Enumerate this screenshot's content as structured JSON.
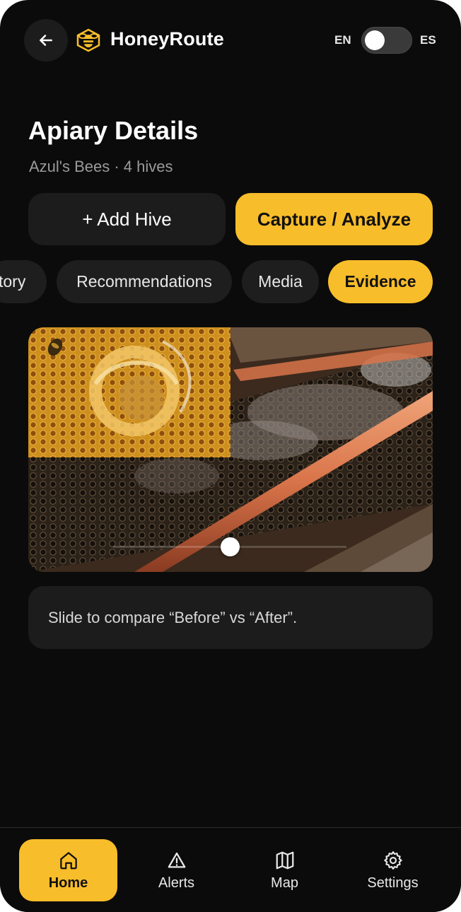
{
  "app": {
    "title": "HoneyRoute",
    "lang_left": "EN",
    "lang_right": "ES",
    "language_toggle_on": false
  },
  "page": {
    "title": "Apiary Details",
    "subtitle": "Azul's Bees · 4 hives"
  },
  "actions": {
    "add_hive": "+ Add Hive",
    "capture": "Capture / Analyze"
  },
  "tabs": [
    {
      "label": "tory",
      "active": false
    },
    {
      "label": "Recommendations",
      "active": false
    },
    {
      "label": "Media",
      "active": false
    },
    {
      "label": "Evidence",
      "active": true
    }
  ],
  "compare": {
    "slider_position": 0.5,
    "hint": "Slide to compare “Before” vs “After”."
  },
  "nav": [
    {
      "label": "Home",
      "icon": "home-icon",
      "active": true
    },
    {
      "label": "Alerts",
      "icon": "alert-triangle-icon",
      "active": false
    },
    {
      "label": "Map",
      "icon": "map-icon",
      "active": false
    },
    {
      "label": "Settings",
      "icon": "gear-icon",
      "active": false
    }
  ],
  "colors": {
    "accent": "#f8bd2a",
    "background": "#0b0b0b",
    "surface": "#1c1c1c"
  }
}
